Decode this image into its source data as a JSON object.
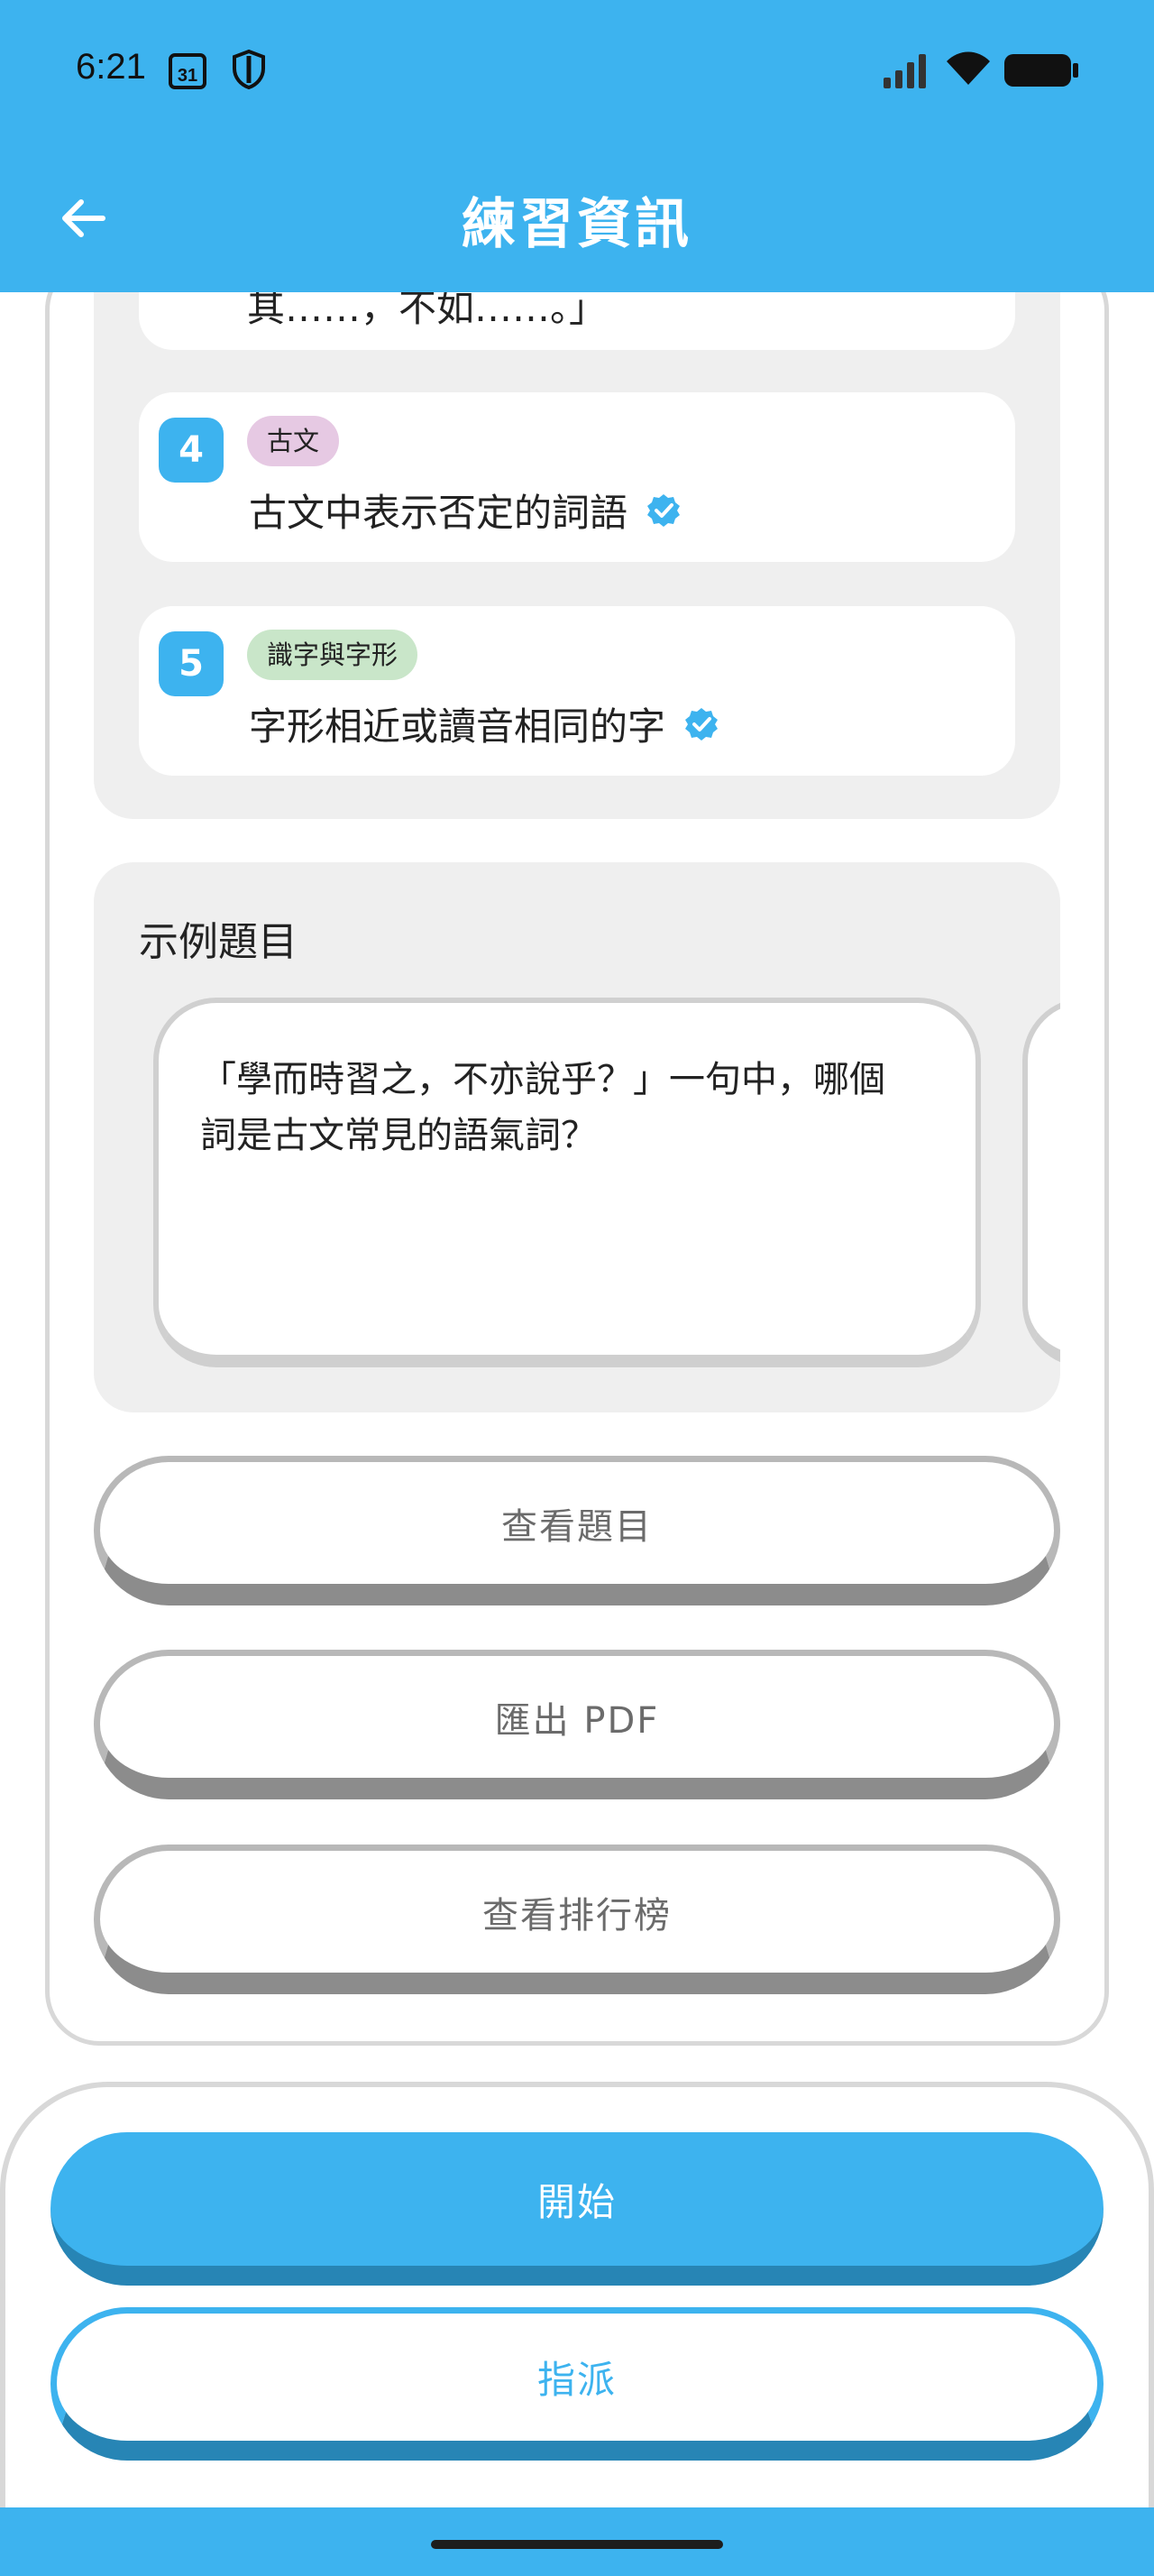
{
  "status_bar": {
    "time": "6:21",
    "calendar_day": "31",
    "icons": [
      "calendar-icon",
      "shield-icon",
      "signal-icon",
      "wifi-icon",
      "battery-icon"
    ]
  },
  "app_bar": {
    "title": "練習資訊",
    "back_icon": "arrow-left-icon"
  },
  "topic_list": {
    "partial_item_text": "其……，不如……。」",
    "items": [
      {
        "number": "4",
        "tag": "古文",
        "tag_color": "#e6c9e3",
        "title": "古文中表示否定的詞語",
        "verified_icon": "verified-badge-icon"
      },
      {
        "number": "5",
        "tag": "識字與字形",
        "tag_color": "#c9e6c9",
        "title": "字形相近或讀音相同的字",
        "verified_icon": "verified-badge-icon"
      }
    ]
  },
  "sample_questions": {
    "heading": "示例題目",
    "cards": [
      {
        "text": "「學而時習之，不亦說乎？」一句中，哪個詞是古文常見的語氣詞？"
      },
      {
        "text": ""
      }
    ]
  },
  "actions": {
    "view_questions": "查看題目",
    "export_pdf": "匯出 PDF",
    "view_leaderboard": "查看排行榜"
  },
  "bottom_sheet": {
    "start": "開始",
    "assign": "指派"
  },
  "colors": {
    "primary": "#3db3ef",
    "primary_dark": "#2785b5",
    "panel": "#efefef"
  }
}
